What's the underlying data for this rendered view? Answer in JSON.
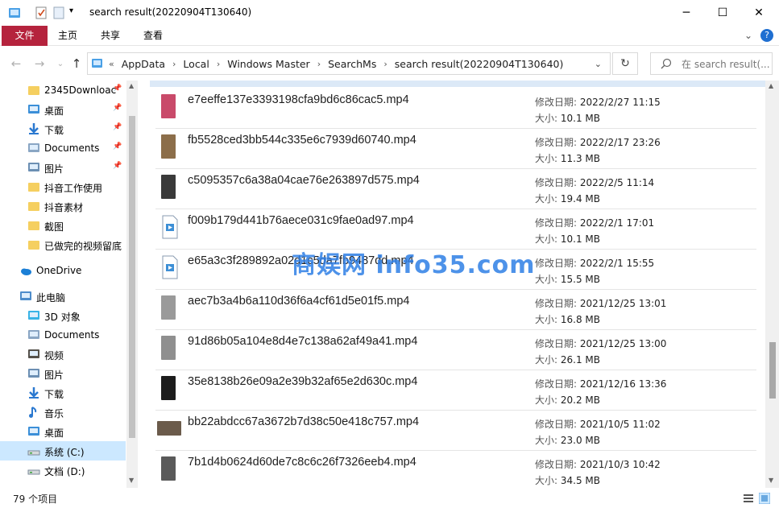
{
  "window": {
    "title": "search result(20220904T130640)"
  },
  "ribbon": {
    "tabs": [
      "文件",
      "主页",
      "共享",
      "查看"
    ]
  },
  "address": {
    "segments": [
      "AppData",
      "Local",
      "Windows Master",
      "SearchMs",
      "search result(20220904T130640)"
    ],
    "search_placeholder": "在 search result(..."
  },
  "nav": {
    "items": [
      {
        "label": "2345Downloac",
        "icon": "folder-icon",
        "pinned": true
      },
      {
        "label": "桌面",
        "icon": "desktop-icon",
        "pinned": true
      },
      {
        "label": "下载",
        "icon": "download-icon",
        "pinned": true
      },
      {
        "label": "Documents",
        "icon": "documents-icon",
        "pinned": true
      },
      {
        "label": "图片",
        "icon": "pictures-icon",
        "pinned": true
      },
      {
        "label": "抖音工作使用",
        "icon": "folder-icon",
        "pinned": false
      },
      {
        "label": "抖音素材",
        "icon": "folder-icon",
        "pinned": false
      },
      {
        "label": "截图",
        "icon": "folder-icon",
        "pinned": false
      },
      {
        "label": "已做完的视频留底",
        "icon": "folder-icon",
        "pinned": false
      },
      {
        "label": "OneDrive",
        "icon": "cloud-icon",
        "pinned": false
      },
      {
        "label": "此电脑",
        "icon": "computer-icon",
        "pinned": false
      },
      {
        "label": "3D 对象",
        "icon": "3d-objects-icon",
        "pinned": false
      },
      {
        "label": "Documents",
        "icon": "documents-icon",
        "pinned": false
      },
      {
        "label": "视频",
        "icon": "videos-icon",
        "pinned": false
      },
      {
        "label": "图片",
        "icon": "pictures-icon",
        "pinned": false
      },
      {
        "label": "下载",
        "icon": "download-icon",
        "pinned": false
      },
      {
        "label": "音乐",
        "icon": "music-icon",
        "pinned": false
      },
      {
        "label": "桌面",
        "icon": "desktop-icon",
        "pinned": false
      },
      {
        "label": "系统 (C:)",
        "icon": "drive-c-icon",
        "pinned": false,
        "selected": true
      },
      {
        "label": "文档 (D:)",
        "icon": "drive-icon",
        "pinned": false
      }
    ]
  },
  "labels": {
    "modified": "修改日期:",
    "size": "大小:"
  },
  "files": [
    {
      "name": "e7eeffe137e3393198cfa9bd6c86cac5.mp4",
      "modified": "2022/2/27 11:15",
      "size": "10.1 MB",
      "thumb": "#c94a6a"
    },
    {
      "name": "fb5528ced3bb544c335e6c7939d60740.mp4",
      "modified": "2022/2/17 23:26",
      "size": "11.3 MB",
      "thumb": "#8c6e4a"
    },
    {
      "name": "c5095357c6a38a04cae76e263897d575.mp4",
      "modified": "2022/2/5 11:14",
      "size": "19.4 MB",
      "thumb": "#3a3a3a"
    },
    {
      "name": "f009b179d441b76aece031c9fae0ad97.mp4",
      "modified": "2022/2/1 17:01",
      "size": "10.1 MB",
      "thumb": "generic"
    },
    {
      "name": "e65a3c3f289892a02d1c5da7fb9487dd.mp4",
      "modified": "2022/2/1 15:55",
      "size": "15.5 MB",
      "thumb": "generic"
    },
    {
      "name": "aec7b3a4b6a110d36f6a4cf61d5e01f5.mp4",
      "modified": "2021/12/25 13:01",
      "size": "16.8 MB",
      "thumb": "#9a9a9a"
    },
    {
      "name": "91d86b05a104e8d4e7c138a62af49a41.mp4",
      "modified": "2021/12/25 13:00",
      "size": "26.1 MB",
      "thumb": "#8f8f8f"
    },
    {
      "name": "35e8138b26e09a2e39b32af65e2d630c.mp4",
      "modified": "2021/12/16 13:36",
      "size": "20.2 MB",
      "thumb": "#1c1c1c"
    },
    {
      "name": "bb22abdcc67a3672b7d38c50e418c757.mp4",
      "modified": "2021/10/5 11:02",
      "size": "23.0 MB",
      "thumb": "#6b5b4b"
    },
    {
      "name": "7b1d4b0624d60de7c8c6c26f7326eeb4.mp4",
      "modified": "2021/10/3 10:42",
      "size": "34.5 MB",
      "thumb": "#5a5a5a"
    }
  ],
  "status": {
    "count": "79 个项目"
  },
  "watermark": "商娱网 info35.com"
}
